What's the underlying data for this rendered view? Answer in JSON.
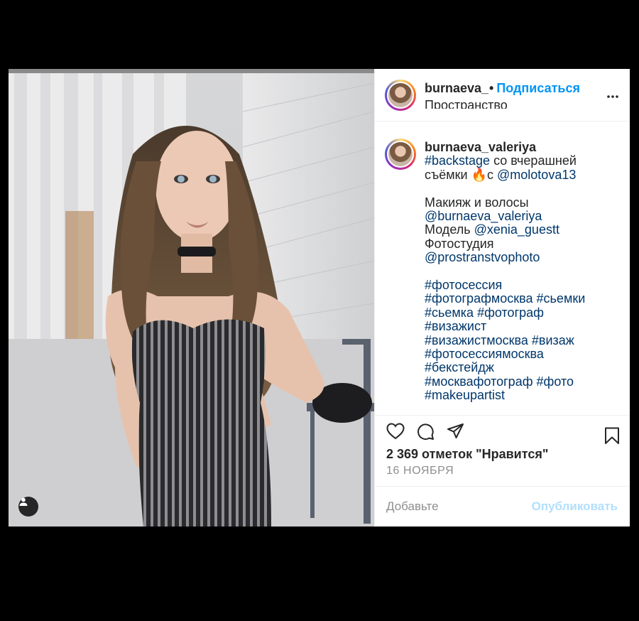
{
  "header": {
    "username": "burnaeva_valeriya",
    "dot": "•",
    "follow_label": "Подписаться",
    "location": "Пространство"
  },
  "caption": {
    "username": "burnaeva_valeriya",
    "line1_tag": "#backstage",
    "line1_text": " со вчерашней",
    "line2_text_a": "съёмки ",
    "line2_emoji": "🔥",
    "line2_text_b": "с ",
    "line2_mention": "@molotova13",
    "makeup_label": "Макияж и волосы",
    "makeup_mention": "@burnaeva_valeriya",
    "model_label": "Модель ",
    "model_mention": "@xenia_guestt",
    "studio_label": "Фотостудия",
    "studio_mention": "@prostranstvophoto",
    "hashtags": [
      "#фотосессия",
      "#фотографмосква",
      "#сьемки",
      "#сьемка",
      "#фотограф",
      "#визажист",
      "#визажистмосква",
      "#визаж",
      "#фотосессиямосква",
      "#бекстейдж",
      "#москвафотограф",
      "#фото",
      "#makeupartist"
    ]
  },
  "likes_text": "2 369 отметок \"Нравится\"",
  "date_text": "16 НОЯБРЯ",
  "comment": {
    "placeholder": "Добавьте",
    "publish_label": "Опубликовать"
  },
  "icons": [
    "heart-icon",
    "comment-icon",
    "share-icon",
    "bookmark-icon",
    "more-icon",
    "user-tag-icon"
  ],
  "colors": {
    "link": "#00376b",
    "follow": "#0095f6",
    "publish_disabled": "#b2dffc",
    "muted": "#8e8e8e"
  }
}
